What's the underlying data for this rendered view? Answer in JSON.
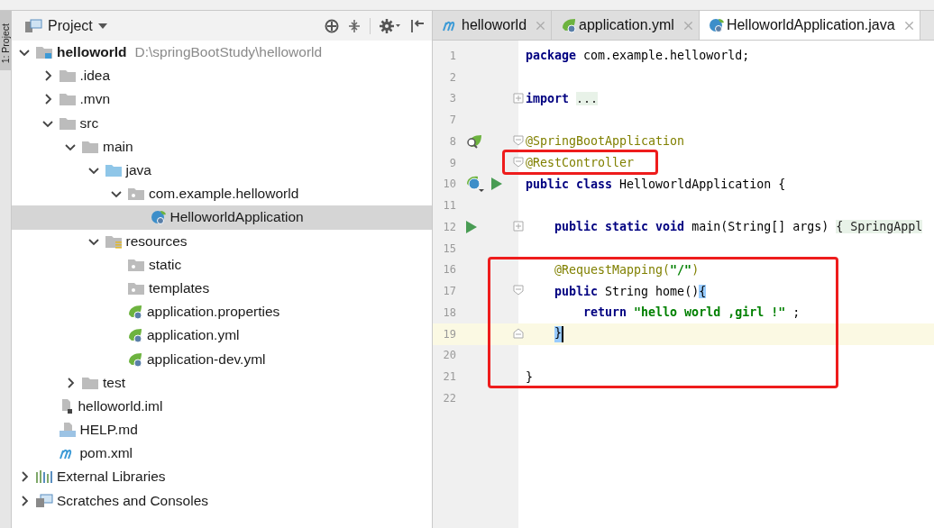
{
  "tool_strip": {
    "label": "1: Project"
  },
  "project_panel": {
    "title": "Project",
    "tree": [
      {
        "label": "helloworld",
        "path": "D:\\springBootStudy\\helloworld",
        "kind": "module",
        "expanded": true,
        "selected": false,
        "children": [
          {
            "label": ".idea",
            "kind": "folder",
            "expanded": false,
            "selected": false
          },
          {
            "label": ".mvn",
            "kind": "folder",
            "expanded": false,
            "selected": false
          },
          {
            "label": "src",
            "kind": "folder",
            "expanded": true,
            "selected": false,
            "children": [
              {
                "label": "main",
                "kind": "folder",
                "expanded": true,
                "selected": false,
                "children": [
                  {
                    "label": "java",
                    "kind": "source-root",
                    "expanded": true,
                    "selected": false,
                    "children": [
                      {
                        "label": "com.example.helloworld",
                        "kind": "package",
                        "expanded": true,
                        "selected": false,
                        "children": [
                          {
                            "label": "HelloworldApplication",
                            "kind": "spring-class",
                            "selected": true
                          }
                        ]
                      }
                    ]
                  },
                  {
                    "label": "resources",
                    "kind": "resource-root",
                    "expanded": true,
                    "selected": false,
                    "children": [
                      {
                        "label": "static",
                        "kind": "package",
                        "selected": false
                      },
                      {
                        "label": "templates",
                        "kind": "package",
                        "selected": false
                      },
                      {
                        "label": "application.properties",
                        "kind": "spring-config",
                        "selected": false
                      },
                      {
                        "label": "application.yml",
                        "kind": "spring-config",
                        "selected": false
                      },
                      {
                        "label": "application-dev.yml",
                        "kind": "spring-config",
                        "selected": false
                      }
                    ]
                  }
                ]
              },
              {
                "label": "test",
                "kind": "folder",
                "expanded": false,
                "selected": false
              }
            ]
          },
          {
            "label": "helloworld.iml",
            "kind": "iml",
            "selected": false
          },
          {
            "label": "HELP.md",
            "kind": "md",
            "selected": false
          },
          {
            "label": "pom.xml",
            "kind": "maven",
            "selected": false
          }
        ]
      },
      {
        "label": "External Libraries",
        "kind": "libraries",
        "expanded": false,
        "selected": false
      },
      {
        "label": "Scratches and Consoles",
        "kind": "scratches",
        "expanded": false,
        "selected": false
      }
    ]
  },
  "editor": {
    "tabs": [
      {
        "label": "helloworld",
        "kind": "maven",
        "selected": false
      },
      {
        "label": "application.yml",
        "kind": "spring-config",
        "selected": false
      },
      {
        "label": "HelloworldApplication.java",
        "kind": "spring-class",
        "selected": true
      }
    ],
    "lines": [
      {
        "number": "1",
        "kind": "top",
        "current": false,
        "tokens": [
          {
            "kind": "keyword",
            "text": "package"
          },
          {
            "kind": "plain",
            "text": " com.example.helloworld;"
          }
        ]
      },
      {
        "number": "2",
        "current": false
      },
      {
        "number": "3",
        "kind": "top",
        "current": false,
        "fold": {
          "kind": "collapsed"
        },
        "tokens": [
          {
            "kind": "keyword",
            "text": "import "
          },
          {
            "kind": "folded",
            "text": "..."
          }
        ]
      },
      {
        "number": "7",
        "current": false
      },
      {
        "number": "8",
        "kind": "top",
        "current": false,
        "fold": {
          "kind": "start"
        },
        "markers": [
          {
            "kind": "spring-beans"
          }
        ],
        "tokens": [
          {
            "kind": "annotation",
            "text": "@SpringBootApplication"
          }
        ]
      },
      {
        "number": "9",
        "kind": "top",
        "current": false,
        "fold": {
          "kind": "start"
        },
        "frame": {
          "kind": "single"
        },
        "tokens": [
          {
            "kind": "annotation",
            "text": "@RestController"
          }
        ]
      },
      {
        "number": "10",
        "kind": "top",
        "current": false,
        "markers": [
          {
            "kind": "spring-class"
          },
          {
            "kind": "run"
          }
        ],
        "tokens": [
          {
            "kind": "keyword",
            "text": "public class"
          },
          {
            "kind": "plain",
            "text": " HelloworldApplication {"
          }
        ]
      },
      {
        "number": "11",
        "current": false
      },
      {
        "number": "12",
        "kind": "member",
        "current": false,
        "fold": {
          "kind": "collapsed"
        },
        "markers": [
          {
            "kind": "run"
          }
        ],
        "tokens": [
          {
            "kind": "keyword",
            "text": "public static void"
          },
          {
            "kind": "plain",
            "text": " main(String[] args) "
          },
          {
            "kind": "folded",
            "text": "{ SpringAppl"
          }
        ]
      },
      {
        "number": "15",
        "current": false
      },
      {
        "number": "16",
        "kind": "member",
        "current": false,
        "frame": {
          "kind": "start"
        },
        "tokens": [
          {
            "kind": "annotation",
            "text": "@RequestMapping("
          },
          {
            "kind": "string",
            "text": "\"/\""
          },
          {
            "kind": "annotation",
            "text": ")"
          }
        ]
      },
      {
        "number": "17",
        "kind": "member",
        "current": false,
        "fold": {
          "kind": "start"
        },
        "tokens": [
          {
            "kind": "keyword",
            "text": "public"
          },
          {
            "kind": "plain",
            "text": " String home()"
          },
          {
            "kind": "brace-match",
            "text": "{"
          }
        ]
      },
      {
        "number": "18",
        "kind": "statement",
        "current": false,
        "tokens": [
          {
            "kind": "keyword",
            "text": "return "
          },
          {
            "kind": "string",
            "text": "\"hello world ,girl !\""
          },
          {
            "kind": "plain",
            "text": " ;"
          }
        ]
      },
      {
        "number": "19",
        "kind": "member",
        "current": true,
        "fold": {
          "kind": "end"
        },
        "tokens": [
          {
            "kind": "brace-match",
            "text": "}"
          }
        ]
      },
      {
        "number": "20",
        "current": false
      },
      {
        "number": "21",
        "kind": "top",
        "current": false,
        "frame": {
          "kind": "end"
        },
        "tokens": [
          {
            "kind": "plain",
            "text": "}"
          }
        ]
      },
      {
        "number": "22",
        "current": false
      }
    ]
  }
}
